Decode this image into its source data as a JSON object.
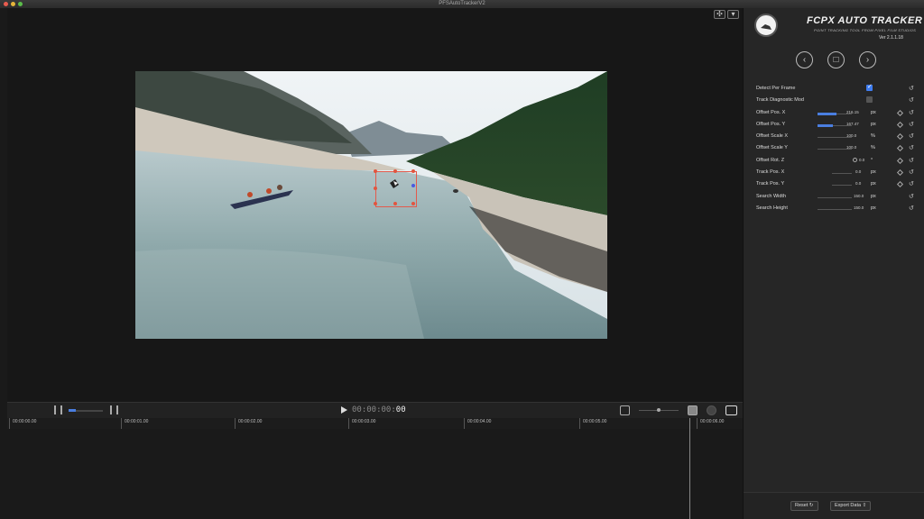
{
  "window": {
    "title": "PFSAutoTrackerV2"
  },
  "plugin": {
    "title": "FCPX AUTO TRACKER",
    "subtitle": "POINT TRACKING TOOL FROM PIXEL FILM STUDIOS",
    "version": "Ver 2.1.1.18"
  },
  "nav": {
    "prev": "‹",
    "stop": "□",
    "next": "›"
  },
  "params": [
    {
      "label": "Detect Per Frame",
      "checked": true
    },
    {
      "label": "Track Diagnostic Mod",
      "checked": false
    },
    {
      "label": "Offset Pos. X",
      "value": "216.15",
      "unit": "px",
      "fill": 0.55
    },
    {
      "label": "Offset Pos. Y",
      "value": "167.47",
      "unit": "px",
      "fill": 0.45
    },
    {
      "label": "Offset Scale X",
      "value": "100.0",
      "unit": "%",
      "fill": 0.0
    },
    {
      "label": "Offset Scale Y",
      "value": "100.0",
      "unit": "%",
      "fill": 0.0
    },
    {
      "label": "Offset Rot. Z",
      "value": "0.0",
      "unit": "°",
      "fill": 0.0
    },
    {
      "label": "Track Pos. X",
      "value": "0.0",
      "unit": "px",
      "fill": 0.0
    },
    {
      "label": "Track Pos. Y",
      "value": "0.0",
      "unit": "px",
      "fill": 0.0
    },
    {
      "label": "Search Width",
      "value": "150.0",
      "unit": "px",
      "fill": 0.0
    },
    {
      "label": "Search Height",
      "value": "150.0",
      "unit": "px",
      "fill": 0.0
    }
  ],
  "buttons": {
    "reset": "Reset",
    "export": "Export Data"
  },
  "timeline": {
    "timecode": "00:00:00:",
    "timecode_end": "00",
    "ruler": [
      "00:00:00.00",
      "00:00:01.00",
      "00:00:02.00",
      "00:00:03.00",
      "00:00:04.00",
      "00:00:05.00",
      "00:00:06.00"
    ]
  },
  "colors": {
    "accent": "#4a7ee0",
    "tracker_box": "#e35a4c",
    "tracker_handle": "#e2553f"
  }
}
